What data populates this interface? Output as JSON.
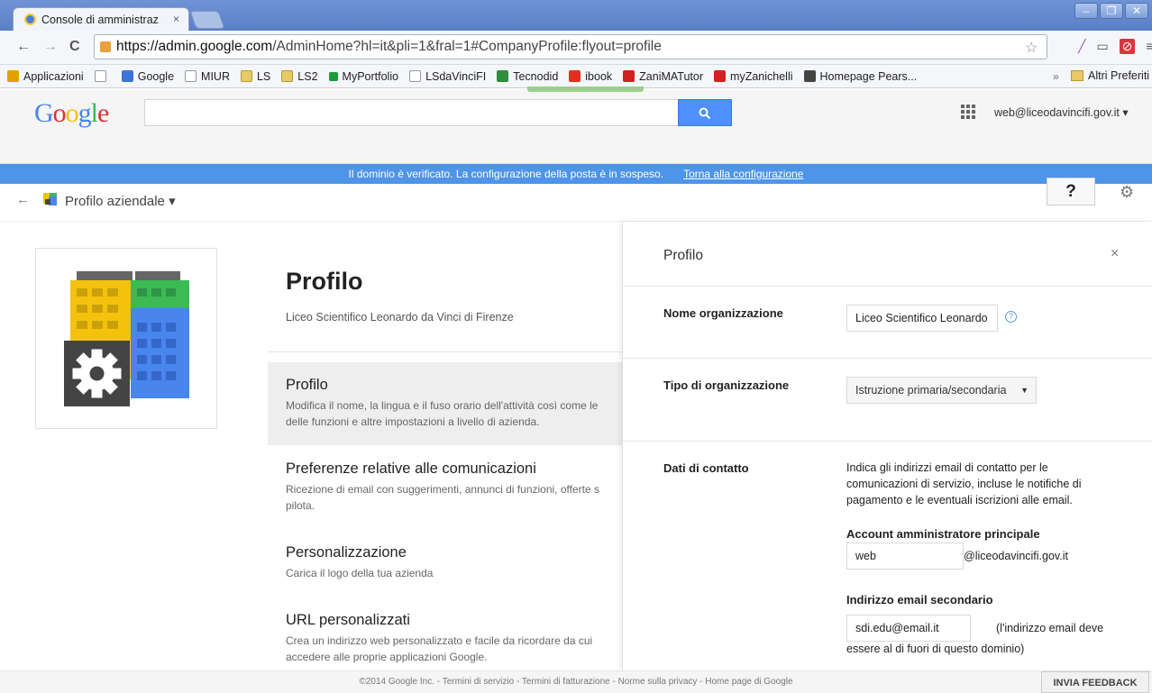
{
  "browser": {
    "tab_title": "Console di amministraz",
    "tab_close": "×",
    "url_host": "https://admin.google.com",
    "url_path": "/AdminHome?hl=it&pli=1&fral=1#CompanyProfile:flyout=profile",
    "bookmarks": [
      {
        "label": "Applicazioni",
        "color": "#e5a100"
      },
      {
        "label": "",
        "color": "#ffffff"
      },
      {
        "label": "Google",
        "color": "#3d74d8"
      },
      {
        "label": "MIUR",
        "color": "#ffffff"
      },
      {
        "label": "LS",
        "color": "#e9c866"
      },
      {
        "label": "LS2",
        "color": "#e9c866"
      },
      {
        "label": "MyPortfolio",
        "color": "#1c9a3c"
      },
      {
        "label": "LSdaVinciFI",
        "color": "#ffffff"
      },
      {
        "label": "Tecnodid",
        "color": "#2f8d3c"
      },
      {
        "label": "ibook",
        "color": "#e1301f"
      },
      {
        "label": "ZaniMATutor",
        "color": "#d32020"
      },
      {
        "label": "myZanichelli",
        "color": "#d32020"
      },
      {
        "label": "Homepage Pears...",
        "color": "#444444"
      }
    ],
    "bookmarks_more": "»",
    "bookmarks_other": "Altri Preferiti"
  },
  "header": {
    "logo": "Google",
    "account": "web@liceodavincifi.gov.it ▾"
  },
  "notice": {
    "text": "Il dominio è verificato. La configurazione della posta è in sospeso.",
    "link": "Torna alla configurazione"
  },
  "breadcrumb": {
    "back": "←",
    "label": "Profilo aziendale ▾",
    "help": "?",
    "gear": "⚙"
  },
  "main": {
    "title": "Profilo",
    "subtitle": "Liceo Scientifico Leonardo da Vinci di Firenze",
    "items": [
      {
        "title": "Profilo",
        "desc1": "Modifica il nome, la lingua e il fuso orario dell'attività così come le",
        "desc2": "delle funzioni e altre impostazioni a livello di azienda."
      },
      {
        "title": "Preferenze relative alle comunicazioni",
        "desc1": "Ricezione di email con suggerimenti, annunci di funzioni, offerte s",
        "desc2": "pilota."
      },
      {
        "title": "Personalizzazione",
        "desc1": "Carica il logo della tua azienda",
        "desc2": ""
      },
      {
        "title": "URL personalizzati",
        "desc1": "Crea un indirizzo web personalizzato e facile da ricordare da cui",
        "desc2": "accedere alle proprie applicazioni Google."
      }
    ]
  },
  "flyout": {
    "title": "Profilo",
    "close": "×",
    "org_name_label": "Nome organizzazione",
    "org_name_value": "Liceo Scientifico Leonardo",
    "org_type_label": "Tipo di organizzazione",
    "org_type_value": "Istruzione primaria/secondaria",
    "contact_label": "Dati di contatto",
    "contact_desc": [
      "Indica gli indirizzi email di contatto per le",
      "comunicazioni di servizio, incluse le notifiche di",
      "pagamento e le eventuali iscrizioni alle email."
    ],
    "admin_label": "Account amministratore principale",
    "admin_value": "web",
    "admin_domain": "@liceodavincifi.gov.it",
    "secondary_label": "Indirizzo email secondario",
    "secondary_value": "sdi.edu@email.it",
    "secondary_note1": "(l'indirizzo email deve",
    "secondary_note2": "essere al di fuori di questo dominio)"
  },
  "footer": {
    "text": "©2014 Google Inc. - Termini di servizio - Termini di fatturazione - Norme sulla privacy - Home page di Google",
    "feedback": "INVIA FEEDBACK"
  }
}
